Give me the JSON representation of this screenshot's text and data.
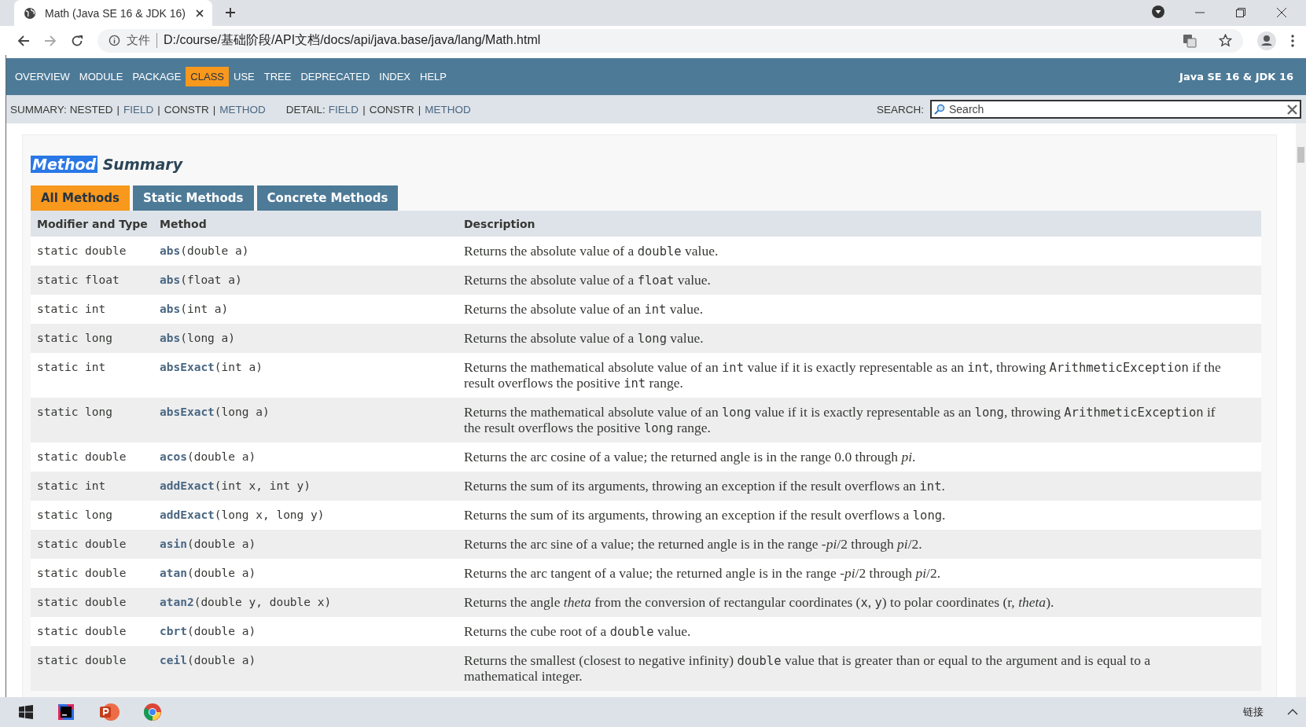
{
  "browser": {
    "tab_title": "Math (Java SE 16 & JDK 16)",
    "address_prefix": "文件",
    "url": "D:/course/基础阶段/API文档/docs/api/java.base/java/lang/Math.html"
  },
  "navbar": {
    "items": [
      {
        "label": "OVERVIEW",
        "selected": false
      },
      {
        "label": "MODULE",
        "selected": false
      },
      {
        "label": "PACKAGE",
        "selected": false
      },
      {
        "label": "CLASS",
        "selected": true
      },
      {
        "label": "USE",
        "selected": false
      },
      {
        "label": "TREE",
        "selected": false
      },
      {
        "label": "DEPRECATED",
        "selected": false
      },
      {
        "label": "INDEX",
        "selected": false
      },
      {
        "label": "HELP",
        "selected": false
      }
    ],
    "title": "Java SE 16 & JDK 16"
  },
  "subnav": {
    "summary_label": "SUMMARY:",
    "summary": [
      {
        "kind": "plain",
        "label": "NESTED"
      },
      {
        "kind": "separator",
        "label": "|"
      },
      {
        "kind": "link",
        "label": "FIELD"
      },
      {
        "kind": "separator",
        "label": "|"
      },
      {
        "kind": "plain",
        "label": "CONSTR"
      },
      {
        "kind": "separator",
        "label": "|"
      },
      {
        "kind": "link",
        "label": "METHOD"
      }
    ],
    "detail_label": "DETAIL:",
    "detail": [
      {
        "kind": "link",
        "label": "FIELD"
      },
      {
        "kind": "separator",
        "label": "|"
      },
      {
        "kind": "plain",
        "label": "CONSTR"
      },
      {
        "kind": "separator",
        "label": "|"
      },
      {
        "kind": "link",
        "label": "METHOD"
      }
    ],
    "search_label": "SEARCH:",
    "search_placeholder": "Search"
  },
  "section": {
    "title_highlight": "Method",
    "title_rest": "Summary",
    "tabs": [
      {
        "label": "All Methods",
        "selected": true
      },
      {
        "label": "Static Methods",
        "selected": false
      },
      {
        "label": "Concrete Methods",
        "selected": false
      }
    ],
    "columns": [
      "Modifier and Type",
      "Method",
      "Description"
    ],
    "rows": [
      {
        "type": "static double",
        "name": "abs",
        "params": "(double a)",
        "description": [
          {
            "kind": "text",
            "text": "Returns the absolute value of a "
          },
          {
            "kind": "code",
            "text": "double"
          },
          {
            "kind": "text",
            "text": " value."
          }
        ]
      },
      {
        "type": "static float",
        "name": "abs",
        "params": "(float a)",
        "description": [
          {
            "kind": "text",
            "text": "Returns the absolute value of a "
          },
          {
            "kind": "code",
            "text": "float"
          },
          {
            "kind": "text",
            "text": " value."
          }
        ]
      },
      {
        "type": "static int",
        "name": "abs",
        "params": "(int a)",
        "description": [
          {
            "kind": "text",
            "text": "Returns the absolute value of an "
          },
          {
            "kind": "code",
            "text": "int"
          },
          {
            "kind": "text",
            "text": " value."
          }
        ]
      },
      {
        "type": "static long",
        "name": "abs",
        "params": "(long a)",
        "description": [
          {
            "kind": "text",
            "text": "Returns the absolute value of a "
          },
          {
            "kind": "code",
            "text": "long"
          },
          {
            "kind": "text",
            "text": " value."
          }
        ]
      },
      {
        "type": "static int",
        "name": "absExact",
        "params": "(int a)",
        "description": [
          {
            "kind": "text",
            "text": "Returns the mathematical absolute value of an "
          },
          {
            "kind": "code",
            "text": "int"
          },
          {
            "kind": "text",
            "text": " value if it is exactly representable as an "
          },
          {
            "kind": "code",
            "text": "int"
          },
          {
            "kind": "text",
            "text": ", throwing "
          },
          {
            "kind": "code",
            "text": "ArithmeticException"
          },
          {
            "kind": "text",
            "text": " if the result overflows the positive "
          },
          {
            "kind": "code",
            "text": "int"
          },
          {
            "kind": "text",
            "text": " range."
          }
        ]
      },
      {
        "type": "static long",
        "name": "absExact",
        "params": "(long a)",
        "description": [
          {
            "kind": "text",
            "text": "Returns the mathematical absolute value of an "
          },
          {
            "kind": "code",
            "text": "long"
          },
          {
            "kind": "text",
            "text": " value if it is exactly representable as an "
          },
          {
            "kind": "code",
            "text": "long"
          },
          {
            "kind": "text",
            "text": ", throwing "
          },
          {
            "kind": "code",
            "text": "ArithmeticException"
          },
          {
            "kind": "text",
            "text": " if the result overflows the positive "
          },
          {
            "kind": "code",
            "text": "long"
          },
          {
            "kind": "text",
            "text": " range."
          }
        ]
      },
      {
        "type": "static double",
        "name": "acos",
        "params": "(double a)",
        "description": [
          {
            "kind": "text",
            "text": "Returns the arc cosine of a value; the returned angle is in the range 0.0 through "
          },
          {
            "kind": "em",
            "text": "pi"
          },
          {
            "kind": "text",
            "text": "."
          }
        ]
      },
      {
        "type": "static int",
        "name": "addExact",
        "params": "(int x, int y)",
        "description": [
          {
            "kind": "text",
            "text": "Returns the sum of its arguments, throwing an exception if the result overflows an "
          },
          {
            "kind": "code",
            "text": "int"
          },
          {
            "kind": "text",
            "text": "."
          }
        ]
      },
      {
        "type": "static long",
        "name": "addExact",
        "params": "(long x, long y)",
        "description": [
          {
            "kind": "text",
            "text": "Returns the sum of its arguments, throwing an exception if the result overflows a "
          },
          {
            "kind": "code",
            "text": "long"
          },
          {
            "kind": "text",
            "text": "."
          }
        ]
      },
      {
        "type": "static double",
        "name": "asin",
        "params": "(double a)",
        "description": [
          {
            "kind": "text",
            "text": "Returns the arc sine of a value; the returned angle is in the range -"
          },
          {
            "kind": "em",
            "text": "pi"
          },
          {
            "kind": "text",
            "text": "/2 through "
          },
          {
            "kind": "em",
            "text": "pi"
          },
          {
            "kind": "text",
            "text": "/2."
          }
        ]
      },
      {
        "type": "static double",
        "name": "atan",
        "params": "(double a)",
        "description": [
          {
            "kind": "text",
            "text": "Returns the arc tangent of a value; the returned angle is in the range -"
          },
          {
            "kind": "em",
            "text": "pi"
          },
          {
            "kind": "text",
            "text": "/2 through "
          },
          {
            "kind": "em",
            "text": "pi"
          },
          {
            "kind": "text",
            "text": "/2."
          }
        ]
      },
      {
        "type": "static double",
        "name": "atan2",
        "params": "(double y, double x)",
        "description": [
          {
            "kind": "text",
            "text": "Returns the angle "
          },
          {
            "kind": "em",
            "text": "theta"
          },
          {
            "kind": "text",
            "text": " from the conversion of rectangular coordinates ("
          },
          {
            "kind": "code",
            "text": "x"
          },
          {
            "kind": "text",
            "text": ", "
          },
          {
            "kind": "code",
            "text": "y"
          },
          {
            "kind": "text",
            "text": ") to polar coordinates (r, "
          },
          {
            "kind": "em",
            "text": "theta"
          },
          {
            "kind": "text",
            "text": ")."
          }
        ]
      },
      {
        "type": "static double",
        "name": "cbrt",
        "params": "(double a)",
        "description": [
          {
            "kind": "text",
            "text": "Returns the cube root of a "
          },
          {
            "kind": "code",
            "text": "double"
          },
          {
            "kind": "text",
            "text": " value."
          }
        ]
      },
      {
        "type": "static double",
        "name": "ceil",
        "params": "(double a)",
        "description": [
          {
            "kind": "text",
            "text": "Returns the smallest (closest to negative infinity) "
          },
          {
            "kind": "code",
            "text": "double"
          },
          {
            "kind": "text",
            "text": " value that is greater than or equal to the argument and is equal to a mathematical integer."
          }
        ]
      }
    ]
  },
  "taskbar": {
    "apps": [
      {
        "kind": "start"
      },
      {
        "kind": "idea"
      },
      {
        "kind": "powerpoint"
      },
      {
        "kind": "chrome"
      }
    ],
    "tray_text": "链接"
  }
}
